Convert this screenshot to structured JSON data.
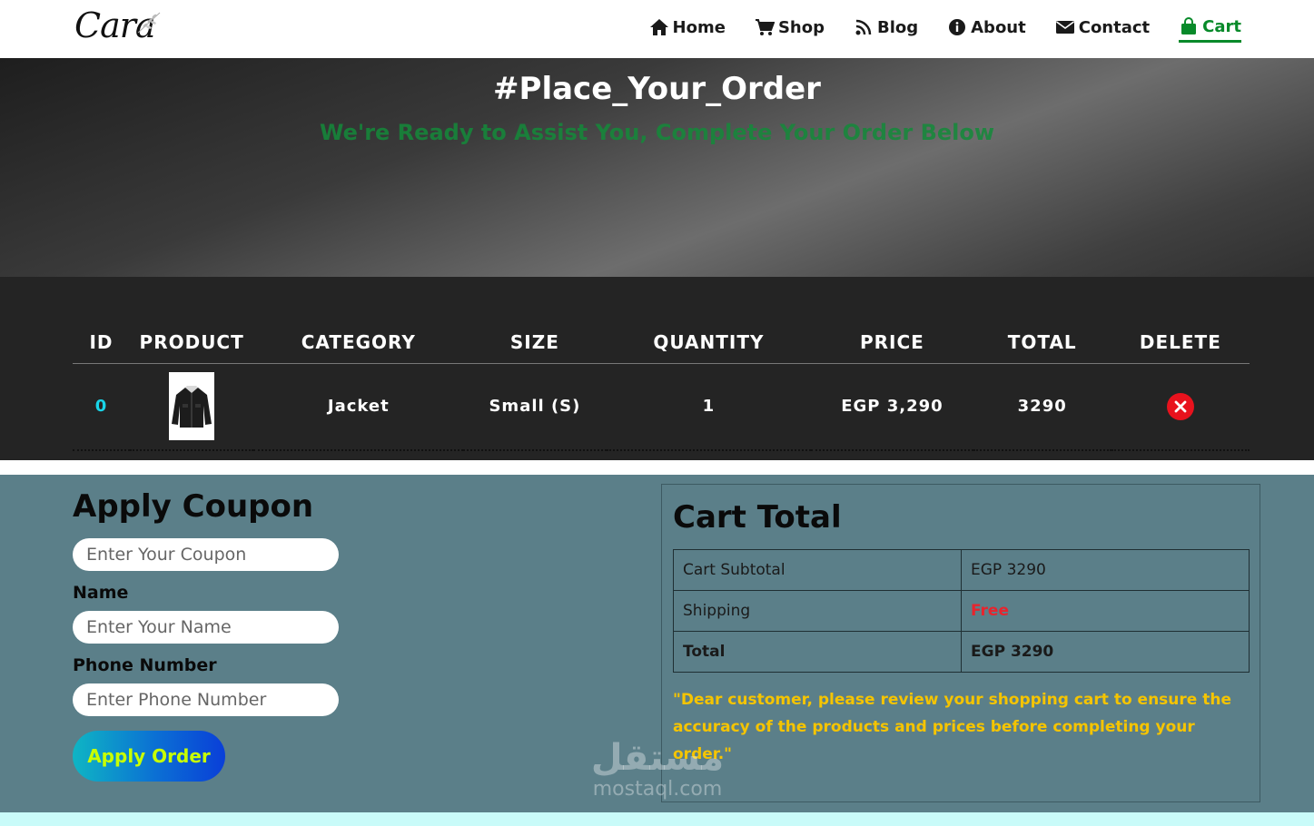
{
  "header": {
    "logo": "Cara",
    "nav": [
      {
        "label": "Home",
        "icon": "home-icon"
      },
      {
        "label": "Shop",
        "icon": "cart-icon"
      },
      {
        "label": "Blog",
        "icon": "rss-icon"
      },
      {
        "label": "About",
        "icon": "info-icon"
      },
      {
        "label": "Contact",
        "icon": "envelope-icon"
      },
      {
        "label": "Cart",
        "icon": "shopping-bag-icon",
        "active": true
      }
    ],
    "active_color": "#088a2a"
  },
  "hero": {
    "title": "#Place_Your_Order",
    "subtitle": "We're Ready to Assist You, Complete Your Order Below"
  },
  "cart_table": {
    "headers": [
      "ID",
      "PRODUCT",
      "CATEGORY",
      "SIZE",
      "QUANTITY",
      "PRICE",
      "TOTAL",
      "DELETE"
    ],
    "rows": [
      {
        "id": "0",
        "product_image": "jacket-image",
        "category": "Jacket",
        "size": "Small (S)",
        "quantity": "1",
        "price": "EGP 3,290",
        "total": "3290",
        "delete_icon": "close-icon"
      }
    ]
  },
  "coupon_form": {
    "title": "Apply Coupon",
    "coupon_placeholder": "Enter Your Coupon",
    "name_label": "Name",
    "name_placeholder": "Enter Your Name",
    "phone_label": "Phone Number",
    "phone_placeholder": "Enter Phone Number",
    "submit_label": "Apply Order"
  },
  "cart_total": {
    "title": "Cart Total",
    "rows": [
      {
        "label": "Cart Subtotal",
        "value": "EGP 3290"
      },
      {
        "label": "Shipping",
        "value": "Free"
      },
      {
        "label": "Total",
        "value": "EGP 3290"
      }
    ],
    "notice": "\"Dear customer, please review your shopping cart to ensure the accuracy of the products and prices before completing your order.\""
  },
  "watermark": {
    "arabic": "مستقل",
    "latin": "mostaql.com"
  },
  "colors": {
    "background": "#5b7f89",
    "free": "#e8242d",
    "notice": "#f5c400",
    "id": "#19d4e8",
    "delete": "#e8121d"
  }
}
